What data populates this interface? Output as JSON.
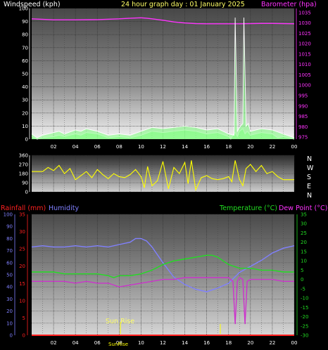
{
  "colors": {
    "wind": "#ffffff",
    "windFill": "#7cff7c",
    "gust": "#d0ffd0",
    "barometer": "#ff33ff",
    "direction": "#ffff00",
    "rain": "#ff2020",
    "humidity": "#8080ff",
    "temperature": "#22dd22",
    "dewpoint": "#cc33cc",
    "title": "#ffff66",
    "sunrise": "#ffff00"
  },
  "top": {
    "title": "24 hour graph day : 01 January 2025",
    "left_label": "Windspeed (kph)",
    "right_label": "Barometer (hpa)"
  },
  "mid": {
    "compass": [
      "N",
      "W",
      "S",
      "E",
      "N"
    ]
  },
  "bottom": {
    "rain_label": "Rainfall (mm)",
    "humidity_label": "Humidity",
    "temp_label": "Temperature (°C)",
    "dew_label": "Dew Point (°C)",
    "sunrise_label": "Sun Rise",
    "sunset_label": "Sun Set",
    "sunrise_marker": "SunRise"
  },
  "chart_data": [
    {
      "type": "line",
      "name": "wind-barometer",
      "title": "24 hour graph day : 01 January 2025",
      "x_ticks": [
        "02",
        "04",
        "06",
        "08",
        "10",
        "12",
        "14",
        "16",
        "18",
        "20",
        "22",
        "00"
      ],
      "xlim": [
        0,
        24
      ],
      "y_left": {
        "label": "Windspeed (kph)",
        "ticks": [
          0,
          10,
          20,
          30,
          40,
          50,
          60,
          70,
          80,
          90,
          100
        ],
        "lim": [
          0,
          100
        ]
      },
      "y_right": {
        "label": "Barometer (hpa)",
        "ticks": [
          975,
          980,
          985,
          990,
          995,
          1000,
          1005,
          1010,
          1015,
          1020,
          1025,
          1030,
          1035
        ],
        "lim": [
          974,
          1037
        ]
      },
      "series": [
        {
          "name": "Barometer (hpa)",
          "axis": "right",
          "x": [
            0,
            2,
            4,
            6,
            8,
            9,
            10,
            10.5,
            11,
            12,
            13,
            14,
            15,
            16,
            17,
            18,
            19,
            20,
            21,
            22,
            23,
            24
          ],
          "values": [
            1032,
            1031.5,
            1031.5,
            1031.6,
            1032,
            1032.3,
            1032.5,
            1032.3,
            1032,
            1031.3,
            1030.5,
            1030,
            1029.7,
            1029.6,
            1029.6,
            1029.6,
            1029.6,
            1029.7,
            1029.8,
            1029.8,
            1029.7,
            1029.6
          ]
        },
        {
          "name": "Windspeed (kph)",
          "axis": "left",
          "x": [
            0,
            0.5,
            1,
            2,
            2.5,
            3,
            4,
            4.5,
            5,
            6,
            7,
            8,
            9,
            10,
            11,
            12,
            13,
            14,
            15,
            16,
            17,
            18,
            18.2,
            18.4,
            18.6,
            18.8,
            19,
            19.3,
            19.5,
            19.7,
            20,
            21,
            22,
            22.5,
            23,
            24
          ],
          "values": [
            2,
            0,
            1,
            2,
            3,
            2,
            4,
            3,
            5,
            4,
            1,
            2,
            1,
            3,
            6,
            5,
            6,
            7,
            6,
            4,
            5,
            2,
            0,
            3,
            5,
            2,
            6,
            8,
            4,
            6,
            3,
            5,
            4,
            1,
            2,
            0
          ]
        },
        {
          "name": "Wind Gust (kph)",
          "axis": "left",
          "x": [
            0,
            0.5,
            1,
            2,
            2.5,
            3,
            4,
            4.5,
            5,
            6,
            7,
            8,
            9,
            10,
            11,
            12,
            13,
            14,
            15,
            16,
            17,
            18,
            18.5,
            18.6,
            18.8,
            19,
            19.3,
            19.4,
            19.6,
            19.8,
            20,
            21,
            22,
            23,
            24
          ],
          "values": [
            4,
            1,
            3,
            5,
            6,
            4,
            7,
            6,
            8,
            6,
            3,
            4,
            3,
            6,
            9,
            8,
            9,
            10,
            9,
            7,
            8,
            4,
            3,
            93,
            6,
            9,
            12,
            93,
            10,
            12,
            6,
            8,
            7,
            4,
            1
          ]
        }
      ]
    },
    {
      "type": "line",
      "name": "wind-direction",
      "x_ticks": [
        "02",
        "04",
        "06",
        "08",
        "10",
        "12",
        "14",
        "16",
        "18",
        "20",
        "22",
        "00"
      ],
      "xlim": [
        0,
        24
      ],
      "y_left": {
        "ticks": [
          0,
          90,
          180,
          270,
          360
        ],
        "lim": [
          0,
          360
        ]
      },
      "series": [
        {
          "name": "Wind Direction",
          "x": [
            0,
            1,
            1.5,
            2,
            2.5,
            3,
            3.5,
            4,
            4.5,
            5,
            5.5,
            6,
            6.5,
            7,
            7.5,
            8,
            8.5,
            9,
            9.5,
            10,
            10.3,
            10.6,
            11,
            11.5,
            12,
            12.5,
            13,
            13.5,
            14,
            14.3,
            14.6,
            15,
            15.5,
            16,
            16.5,
            17,
            17.5,
            18,
            18.3,
            18.6,
            19,
            19.3,
            19.6,
            20,
            20.5,
            21,
            21.5,
            22,
            22.5,
            23,
            24
          ],
          "values": [
            200,
            200,
            240,
            210,
            260,
            180,
            230,
            120,
            160,
            200,
            140,
            220,
            170,
            130,
            180,
            150,
            140,
            170,
            220,
            150,
            40,
            250,
            60,
            110,
            300,
            30,
            240,
            180,
            290,
            80,
            310,
            20,
            140,
            160,
            130,
            120,
            130,
            150,
            100,
            310,
            120,
            60,
            230,
            270,
            200,
            260,
            180,
            200,
            150,
            120,
            120
          ]
        }
      ]
    },
    {
      "type": "line",
      "name": "rain-humidity-temp",
      "x_ticks": [
        "02",
        "04",
        "06",
        "08",
        "10",
        "12",
        "14",
        "16",
        "18",
        "20",
        "22",
        "00"
      ],
      "xlim": [
        0,
        24
      ],
      "y_humidity": {
        "label": "Humidity",
        "ticks": [
          0,
          10,
          20,
          30,
          40,
          50,
          60,
          70,
          80,
          90,
          100
        ],
        "lim": [
          0,
          100
        ]
      },
      "y_rain": {
        "label": "Rainfall (mm)",
        "ticks": [
          0,
          5,
          10,
          15,
          20,
          25,
          30,
          35
        ],
        "lim": [
          0,
          35
        ]
      },
      "y_temp": {
        "label": "Temperature (°C)",
        "ticks": [
          -30,
          -25,
          -20,
          -15,
          -10,
          -5,
          0,
          5,
          10,
          15,
          20,
          25,
          30,
          35
        ],
        "lim": [
          -30,
          35
        ]
      },
      "series": [
        {
          "name": "Humidity",
          "axis": "humidity",
          "x": [
            0,
            1,
            2,
            3,
            4,
            5,
            6,
            7,
            8,
            9,
            9.5,
            10,
            10.5,
            11,
            12,
            13,
            14,
            15,
            16,
            17,
            18,
            19,
            20,
            21,
            22,
            23,
            24
          ],
          "values": [
            73,
            74,
            73,
            73,
            74,
            73,
            74,
            73,
            75,
            77,
            80,
            80,
            78,
            73,
            60,
            48,
            42,
            38,
            36,
            39,
            43,
            52,
            57,
            62,
            68,
            72,
            74
          ]
        },
        {
          "name": "Temperature (°C)",
          "axis": "temp",
          "x": [
            0,
            1,
            2,
            3,
            4,
            5,
            6,
            7,
            7.5,
            8,
            9,
            10,
            11,
            12,
            13,
            14,
            15,
            16,
            16.5,
            17,
            18,
            19,
            20,
            21,
            22,
            23,
            24
          ],
          "values": [
            4,
            4,
            4,
            3,
            3,
            3,
            3,
            2,
            1,
            2,
            2,
            3,
            5,
            8,
            10,
            11,
            12,
            13,
            13,
            12,
            8,
            6,
            6,
            5,
            5,
            4,
            4
          ]
        },
        {
          "name": "Dew Point (°C)",
          "axis": "temp",
          "x": [
            0,
            1,
            2,
            3,
            4,
            5,
            6,
            7,
            8,
            9,
            10,
            11,
            12,
            13,
            14,
            15,
            16,
            17,
            18,
            18.4,
            18.6,
            18.8,
            19,
            19.3,
            19.5,
            19.7,
            20,
            21,
            22,
            23,
            24
          ],
          "values": [
            -1,
            -1,
            -1,
            -1,
            -2,
            -1,
            -2,
            -2,
            -4,
            -3,
            -2,
            -1,
            0,
            0,
            1,
            1,
            1,
            1,
            1,
            -1,
            -24,
            -1,
            1,
            0,
            -24,
            -1,
            0,
            0,
            0,
            -1,
            -1
          ]
        },
        {
          "name": "Rainfall (mm)",
          "axis": "rain",
          "x": [
            0,
            24
          ],
          "values": [
            0,
            0
          ]
        }
      ]
    }
  ]
}
